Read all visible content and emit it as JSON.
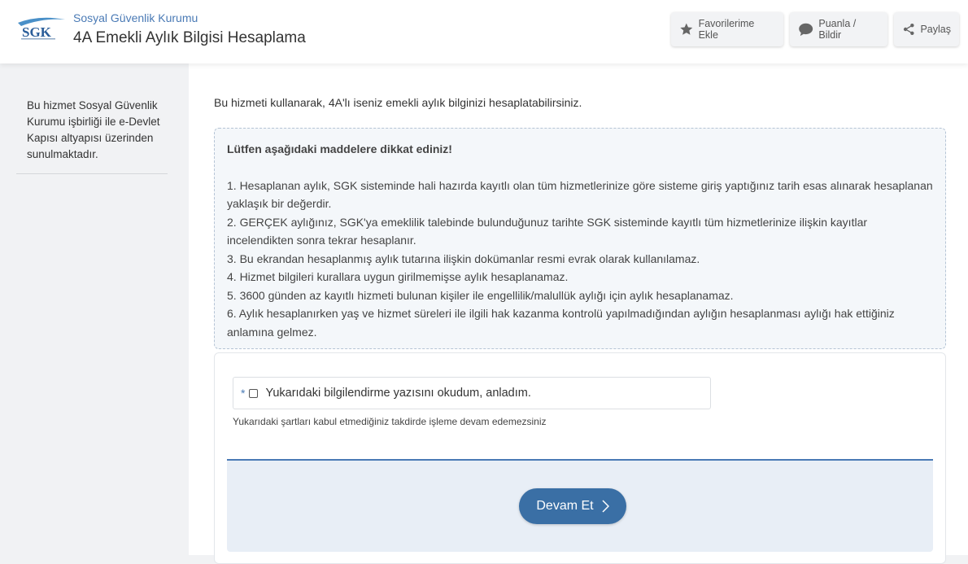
{
  "header": {
    "org_name": "Sosyal Güvenlik Kurumu",
    "page_title": "4A Emekli Aylık Bilgisi Hesaplama",
    "logo_text": "SGK",
    "buttons": {
      "favorite": "Favorilerime Ekle",
      "rate": "Puanla / Bildir",
      "share": "Paylaş"
    }
  },
  "sidebar": {
    "info_text": "Bu hizmet Sosyal Güvenlik Kurumu işbirliği ile e-Devlet Kapısı altyapısı üzerinden sunulmaktadır."
  },
  "main": {
    "intro": "Bu hizmeti kullanarak, 4A'lı iseniz emekli aylık bilginizi hesaplatabilirsiniz.",
    "notice": {
      "title": "Lütfen aşağıdaki maddelere dikkat ediniz!",
      "items": [
        "1. Hesaplanan aylık, SGK sisteminde hali hazırda kayıtlı olan tüm hizmetlerinize göre sisteme giriş yaptığınız tarih esas alınarak hesaplanan yaklaşık bir değerdir.",
        "2. GERÇEK aylığınız, SGK'ya emeklilik talebinde bulunduğunuz tarihte SGK sisteminde kayıtlı tüm hizmetlerinize ilişkin kayıtlar incelendikten sonra tekrar hesaplanır.",
        "3. Bu ekrandan hesaplanmış aylık tutarına ilişkin dokümanlar resmi evrak olarak kullanılamaz.",
        "4. Hizmet bilgileri kurallara uygun girilmemişse aylık hesaplanamaz.",
        "5. 3600 günden az kayıtlı hizmeti bulunan kişiler ile engellilik/malullük aylığı için aylık hesaplanamaz.",
        "6. Aylık hesaplanırken yaş ve hizmet süreleri ile ilgili hak kazanma kontrolü yapılmadığından aylığın hesaplanması aylığı hak ettiğiniz anlamına gelmez."
      ]
    },
    "form": {
      "required_mark": "*",
      "checkbox_label": "Yukarıdaki bilgilendirme yazısını okudum, anladım.",
      "checkbox_checked": false,
      "help_text": "Yukarıdaki şartları kabul etmediğiniz takdirde işleme devam edemezsiniz",
      "continue_label": "Devam Et"
    }
  },
  "colors": {
    "accent": "#3a6fa5",
    "org_text": "#4a7ab5"
  },
  "icons": [
    "star-icon",
    "chat-bubble-icon",
    "share-icon",
    "chevron-right-icon"
  ]
}
